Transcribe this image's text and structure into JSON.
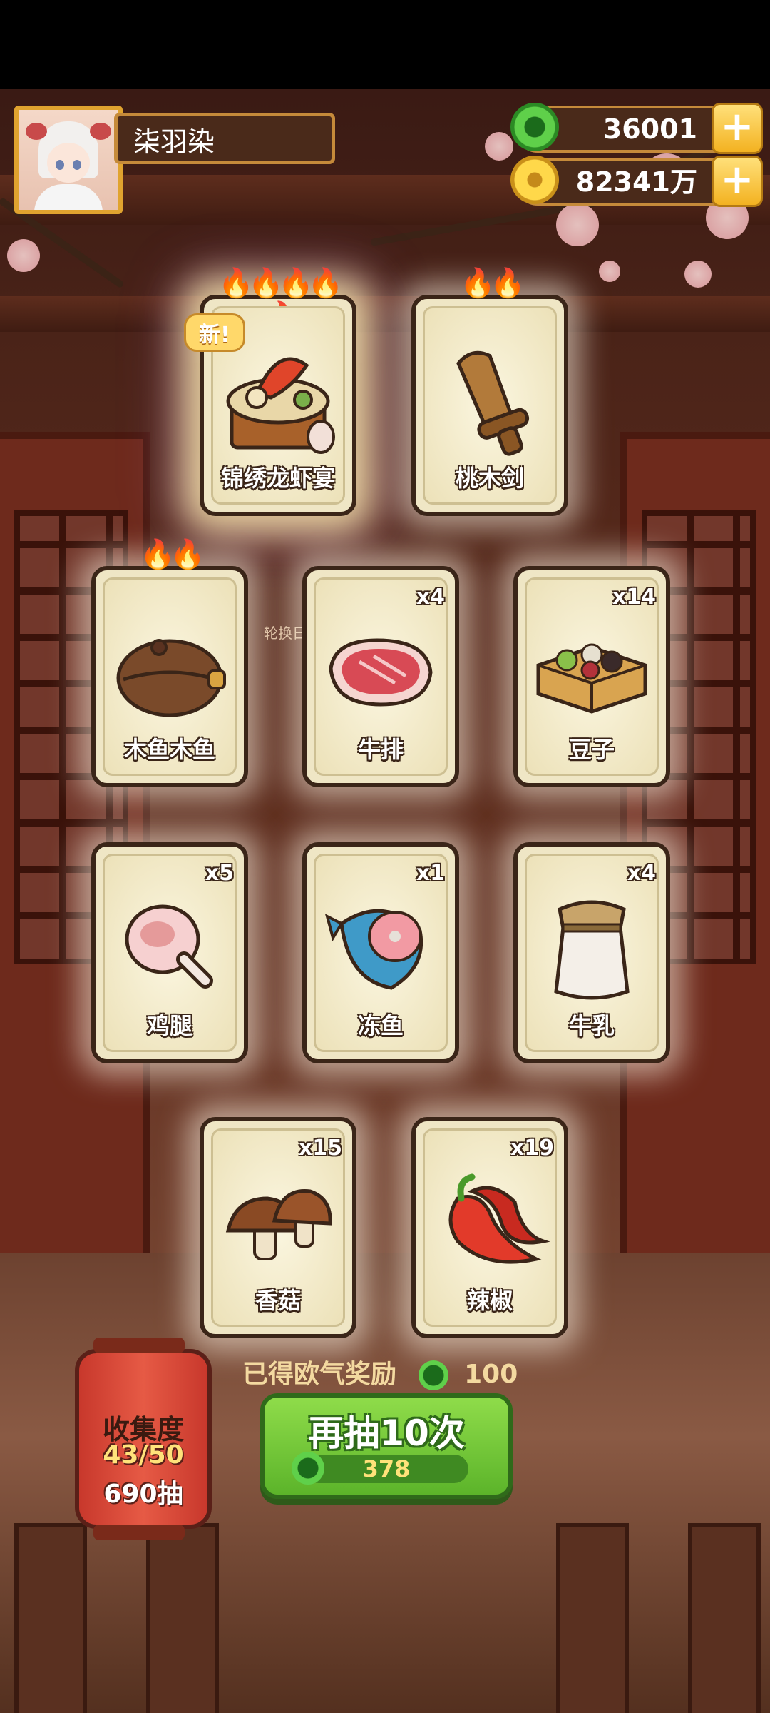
{
  "player": {
    "name": "柒羽染"
  },
  "currency": {
    "jade": {
      "value": "36001",
      "icon": "jade-coin-icon"
    },
    "gold": {
      "value": "82341万",
      "icon": "gold-coin-icon"
    },
    "add_symbol": "+"
  },
  "new_tag": "新!",
  "scene_caption": "轮换日历",
  "cards": [
    {
      "label": "锦绣龙虾宴",
      "qty": "",
      "flames": "🔥🔥🔥🔥🔥",
      "rare": true,
      "icon": "lobster-feast-icon"
    },
    {
      "label": "桃木剑",
      "qty": "",
      "flames": "🔥🔥",
      "icon": "peach-wood-sword-icon"
    },
    {
      "label": "木鱼木鱼",
      "qty": "",
      "flames": "🔥🔥",
      "icon": "wooden-fish-icon"
    },
    {
      "label": "牛排",
      "qty": "x4",
      "icon": "steak-icon"
    },
    {
      "label": "豆子",
      "qty": "x14",
      "icon": "beans-box-icon"
    },
    {
      "label": "鸡腿",
      "qty": "x5",
      "icon": "chicken-leg-icon"
    },
    {
      "label": "冻鱼",
      "qty": "x1",
      "icon": "frozen-fish-icon"
    },
    {
      "label": "牛乳",
      "qty": "x4",
      "icon": "milk-jar-icon"
    },
    {
      "label": "香菇",
      "qty": "x15",
      "icon": "mushroom-icon"
    },
    {
      "label": "辣椒",
      "qty": "x19",
      "icon": "chili-icon"
    }
  ],
  "collection": {
    "title": "收集度",
    "progress": "43/50",
    "draws": "690抽"
  },
  "reward": {
    "label": "已得欧气奖励",
    "value": "100"
  },
  "draw_button": {
    "label": "再抽10次",
    "cost": "378"
  },
  "colors": {
    "accent_green": "#5cb42a",
    "frame_gold": "#c58a3a",
    "card_bg": "#efe6c5"
  }
}
